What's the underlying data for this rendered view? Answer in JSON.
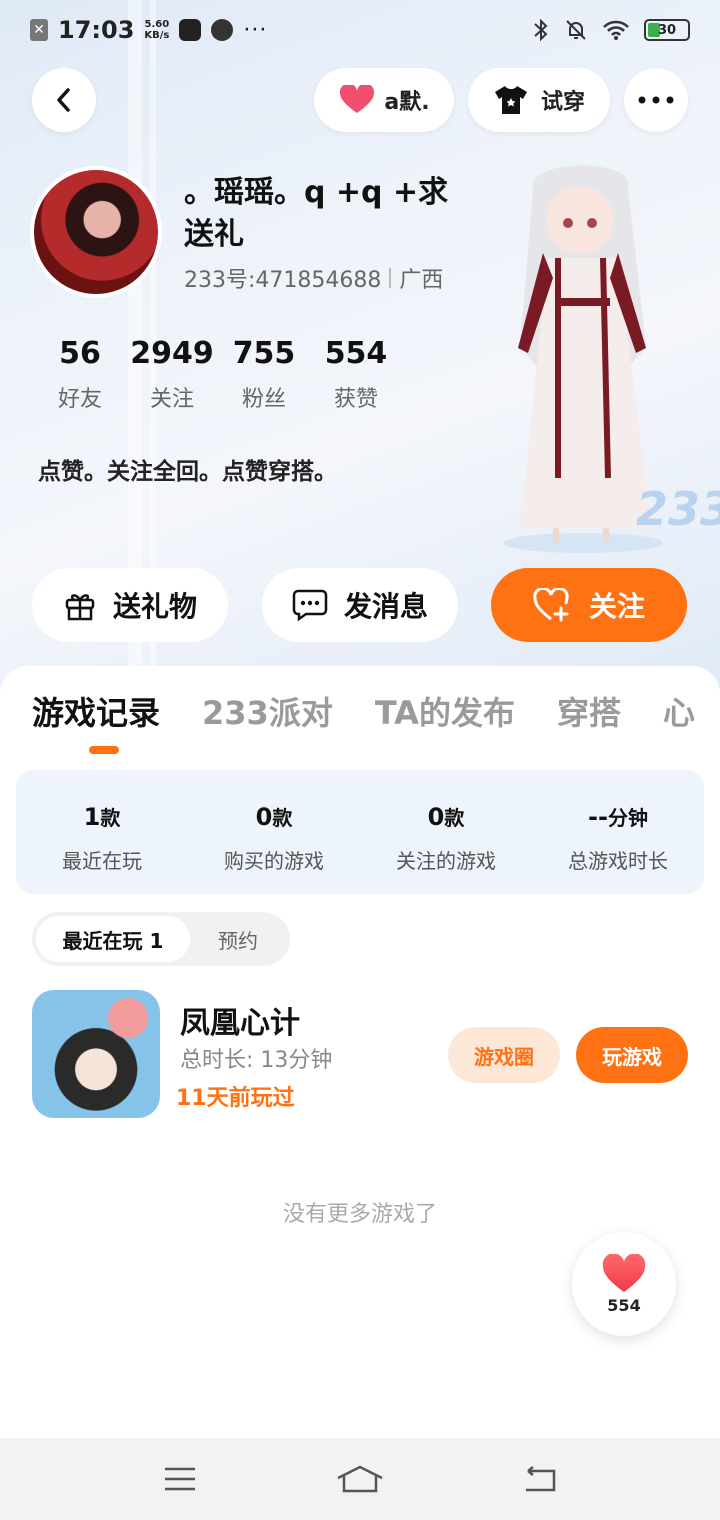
{
  "status_bar": {
    "time": "17:03",
    "speed_value": "5.60",
    "speed_unit": "KB/s",
    "dots": "···",
    "battery": "30"
  },
  "header": {
    "like_label": "a默.",
    "try_on_label": "试穿"
  },
  "profile": {
    "username": "。瑶瑶。q +q +求送礼",
    "uid": "233号:471854688",
    "region": "广西",
    "stats": [
      {
        "value": "56",
        "label": "好友"
      },
      {
        "value": "2949",
        "label": "关注"
      },
      {
        "value": "755",
        "label": "粉丝"
      },
      {
        "value": "554",
        "label": "获赞"
      }
    ],
    "bio": "点赞。关注全回。点赞穿搭。",
    "logo_text": "233"
  },
  "actions": {
    "gift": "送礼物",
    "message": "发消息",
    "follow": "关注"
  },
  "tabs": [
    "游戏记录",
    "233派对",
    "TA的发布",
    "穿搭",
    "心"
  ],
  "summary": [
    {
      "value": "1",
      "unit": "款",
      "label": "最近在玩"
    },
    {
      "value": "0",
      "unit": "款",
      "label": "购买的游戏"
    },
    {
      "value": "0",
      "unit": "款",
      "label": "关注的游戏"
    },
    {
      "value": "--",
      "unit": "分钟",
      "label": "总游戏时长"
    }
  ],
  "segment": {
    "recent": "最近在玩 1",
    "reserve": "预约"
  },
  "game": {
    "name": "凤凰心计",
    "total_time": "总时长: 13分钟",
    "last_played": "11天前玩过",
    "circle_btn": "游戏圈",
    "play_btn": "玩游戏"
  },
  "no_more": "没有更多游戏了",
  "fab": {
    "count": "554"
  },
  "colors": {
    "accent": "#ff7214",
    "pink": "#f0506e"
  }
}
